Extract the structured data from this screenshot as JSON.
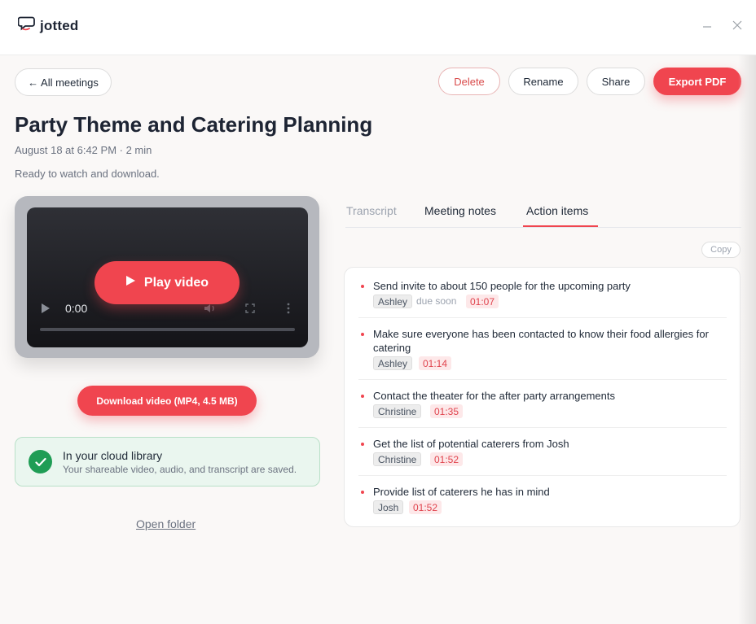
{
  "app": {
    "name": "jotted"
  },
  "toolbar": {
    "back_label": "← All meetings",
    "delete_label": "Delete",
    "rename_label": "Rename",
    "share_label": "Share",
    "export_label": "Export PDF"
  },
  "meeting": {
    "title": "Party Theme and Catering Planning",
    "meta": "August 18 at 6:42 PM · 2 min",
    "status": "Ready to watch and download."
  },
  "video": {
    "play_label": "Play video",
    "time": "0:00",
    "download_label": "Download video (MP4, 4.5 MB)"
  },
  "cloud": {
    "title": "In your cloud library",
    "subtitle": "Your shareable video, audio, and transcript are saved."
  },
  "open_folder_label": "Open folder",
  "tabs": [
    {
      "label": "Transcript"
    },
    {
      "label": "Meeting notes"
    },
    {
      "label": "Action items"
    }
  ],
  "copy_label": "Copy",
  "action_items": [
    {
      "text": "Send invite to about 150 people for the upcoming party",
      "person": "Ashley",
      "note": "due soon",
      "time": "01:07"
    },
    {
      "text": "Make sure everyone has been contacted to know their food allergies for catering",
      "person": "Ashley",
      "time": "01:14"
    },
    {
      "text": "Contact the theater for the after party arrangements",
      "person": "Christine",
      "time": "01:35"
    },
    {
      "text": "Get the list of potential caterers from Josh",
      "person": "Christine",
      "time": "01:52"
    },
    {
      "text": "Provide list of caterers he has in mind",
      "person": "Josh",
      "time": "01:52"
    }
  ],
  "colors": {
    "accent": "#f0454f",
    "success": "#1f9d55"
  },
  "icons": [
    "chat-logo-icon",
    "minimize-icon",
    "close-icon",
    "play-icon",
    "volume-icon",
    "fullscreen-icon",
    "more-vertical-icon",
    "check-icon"
  ]
}
